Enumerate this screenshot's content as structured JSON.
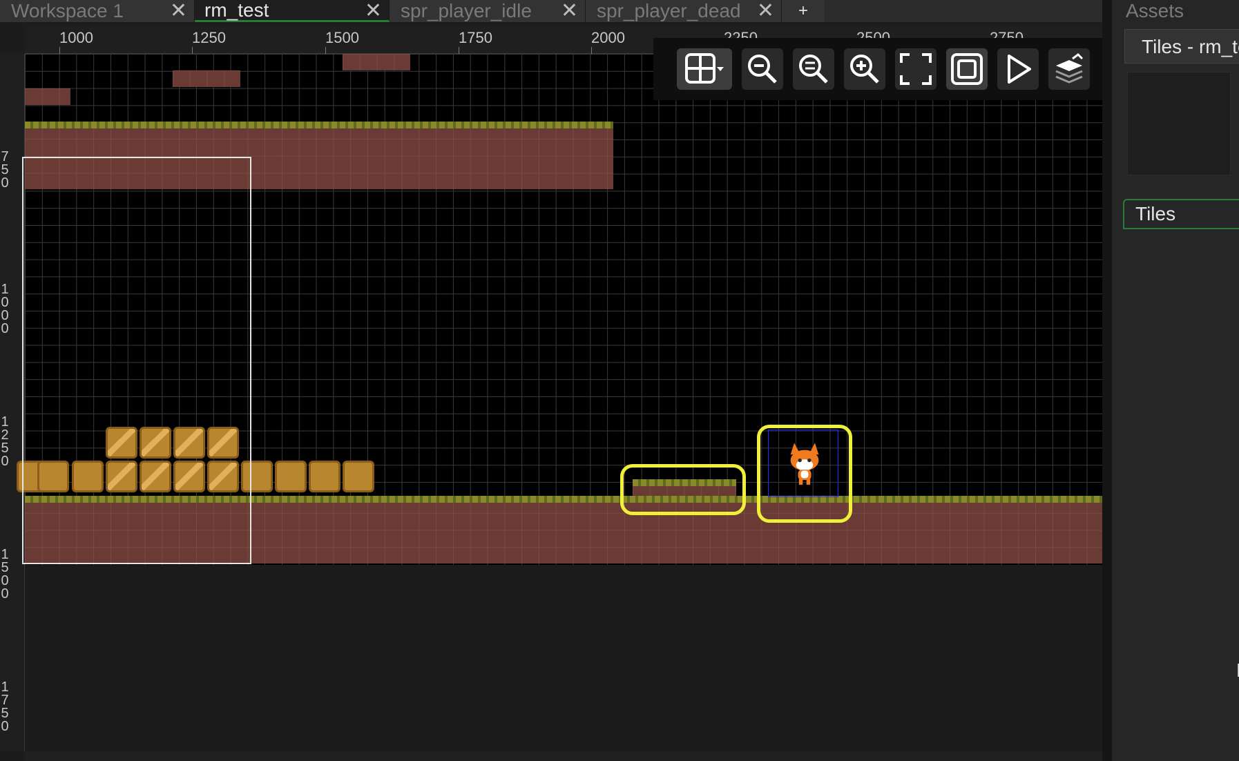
{
  "tabs": [
    {
      "label": "Workspace 1",
      "active": false
    },
    {
      "label": "rm_test",
      "active": true
    },
    {
      "label": "spr_player_idle",
      "active": false
    },
    {
      "label": "spr_player_dead",
      "active": false
    }
  ],
  "tab_close_glyph": "✕",
  "tab_add_label": "+",
  "ruler_top_labels": [
    "1000",
    "1250",
    "1500",
    "1750",
    "2000",
    "2250",
    "2500",
    "2750"
  ],
  "ruler_left_labels": [
    [
      "7",
      "5",
      "0"
    ],
    [
      "1",
      "0",
      "0",
      "0"
    ],
    [
      "1",
      "2",
      "5",
      "0"
    ],
    [
      "1",
      "5",
      "0",
      "0"
    ],
    [
      "1",
      "7",
      "5",
      "0"
    ]
  ],
  "toolbar": {
    "icons": [
      "grid-toggle-icon",
      "zoom-out-icon",
      "zoom-reset-icon",
      "zoom-in-icon",
      "fullscreen-icon",
      "frame-icon",
      "play-icon",
      "layers-icon"
    ]
  },
  "right_panel": {
    "title": "Assets",
    "tab_label": "Tiles - rm_te",
    "subtab_label": "Tiles",
    "bottom_label": "N"
  },
  "colors": {
    "accent": "#2a7a3a",
    "highlight": "#f0f03a",
    "ground": "#6a3a34",
    "grass": "#8a8a2a",
    "crate": "#b8862e"
  }
}
